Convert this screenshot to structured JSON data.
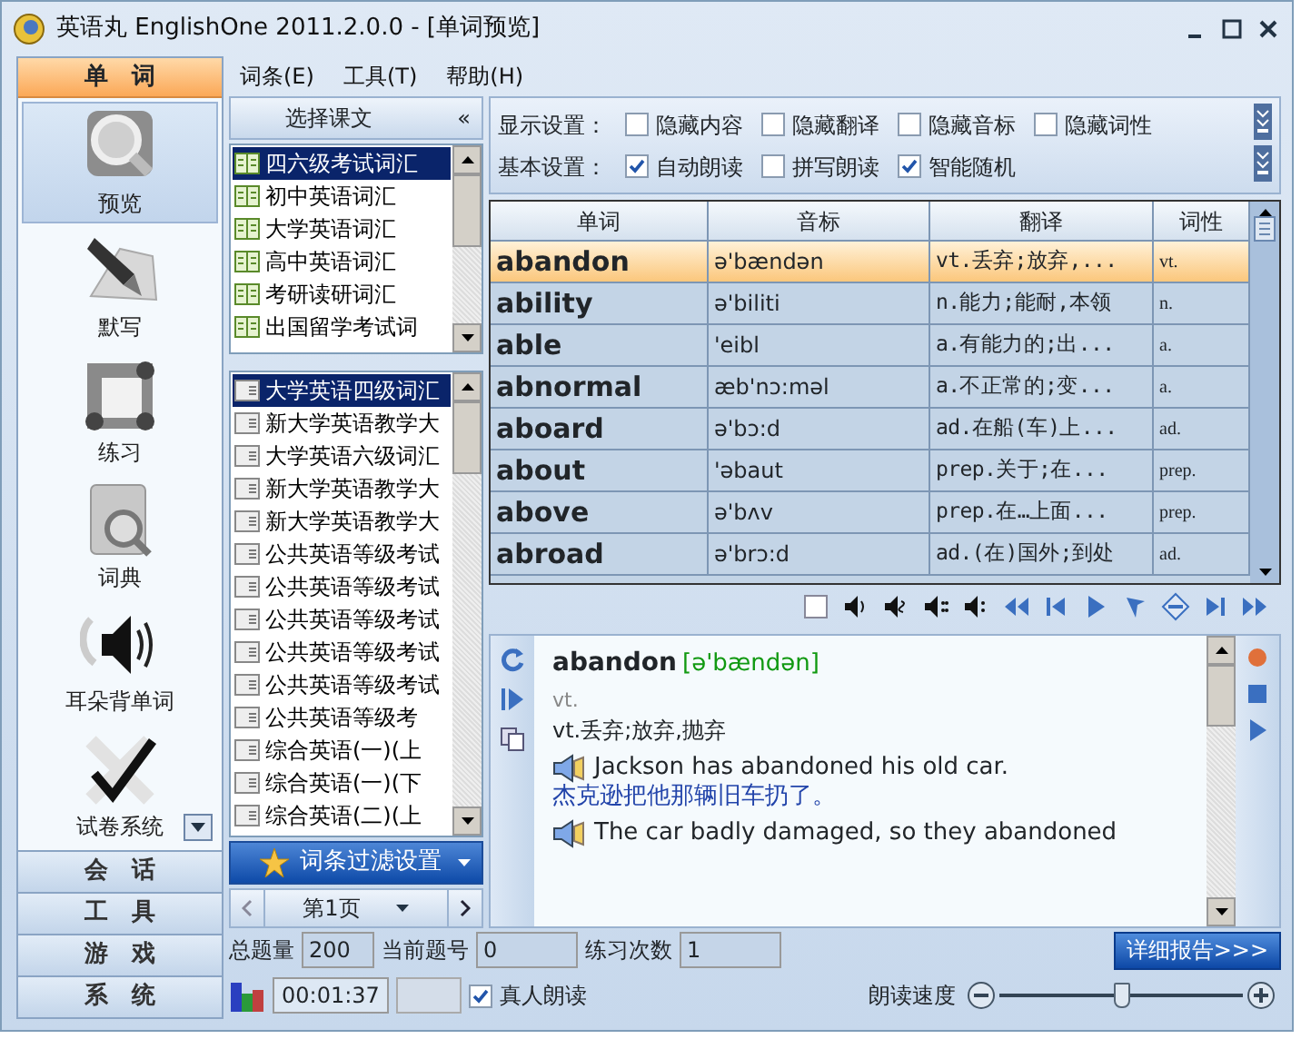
{
  "window": {
    "title": "英语丸  EnglishOne 2011.2.0.0 - [单词预览]"
  },
  "sidebar": {
    "header": "单　词",
    "tools": [
      {
        "label": "预览",
        "kind": "magnifier",
        "selected": true
      },
      {
        "label": "默写",
        "kind": "pen",
        "selected": false
      },
      {
        "label": "练习",
        "kind": "practice",
        "selected": false
      },
      {
        "label": "词典",
        "kind": "dictionary",
        "selected": false
      },
      {
        "label": "耳朵背单词",
        "kind": "speaker",
        "selected": false
      },
      {
        "label": "试卷系统",
        "kind": "check",
        "selected": false
      }
    ],
    "sections": [
      "会　话",
      "工　具",
      "游　戏",
      "系　统"
    ]
  },
  "menu": [
    "词条(E)",
    "工具(T)",
    "帮助(H)"
  ],
  "courses": {
    "title": "选择课文",
    "collapse": "«",
    "categories": [
      {
        "label": "四六级考试词汇",
        "selected": true
      },
      {
        "label": "初中英语词汇",
        "selected": false
      },
      {
        "label": "大学英语词汇",
        "selected": false
      },
      {
        "label": "高中英语词汇",
        "selected": false
      },
      {
        "label": "考研读研词汇",
        "selected": false
      },
      {
        "label": "出国留学考试词",
        "selected": false
      }
    ],
    "books": [
      {
        "label": "大学英语四级词汇",
        "selected": true
      },
      {
        "label": "新大学英语教学大",
        "selected": false
      },
      {
        "label": "大学英语六级词汇",
        "selected": false
      },
      {
        "label": "新大学英语教学大",
        "selected": false
      },
      {
        "label": "新大学英语教学大",
        "selected": false
      },
      {
        "label": "公共英语等级考试",
        "selected": false
      },
      {
        "label": "公共英语等级考试",
        "selected": false
      },
      {
        "label": "公共英语等级考试",
        "selected": false
      },
      {
        "label": "公共英语等级考试",
        "selected": false
      },
      {
        "label": "公共英语等级考试",
        "selected": false
      },
      {
        "label": "公共英语等级考",
        "selected": false
      },
      {
        "label": "综合英语(一)(上",
        "selected": false
      },
      {
        "label": "综合英语(一)(下",
        "selected": false
      },
      {
        "label": "综合英语(二)(上",
        "selected": false
      }
    ],
    "filter_button": "词条过滤设置",
    "page": "第1页"
  },
  "settings": {
    "display_label": "显示设置：",
    "display": [
      {
        "label": "隐藏内容",
        "checked": false
      },
      {
        "label": "隐藏翻译",
        "checked": false
      },
      {
        "label": "隐藏音标",
        "checked": false
      },
      {
        "label": "隐藏词性",
        "checked": false
      }
    ],
    "basic_label": "基本设置：",
    "basic": [
      {
        "label": "自动朗读",
        "checked": true
      },
      {
        "label": "拼写朗读",
        "checked": false
      },
      {
        "label": "智能随机",
        "checked": true
      }
    ]
  },
  "table": {
    "columns": [
      "单词",
      "音标",
      "翻译",
      "词性"
    ],
    "rows": [
      {
        "word": "abandon",
        "phonetic": "ə'bændən",
        "translation": "vt.丢弃;放弃,...",
        "pos": "vt.",
        "selected": true
      },
      {
        "word": "ability",
        "phonetic": "ə'biliti",
        "translation": "n.能力;能耐,本领",
        "pos": "n.",
        "selected": false
      },
      {
        "word": "able",
        "phonetic": "'eibl",
        "translation": "a.有能力的;出...",
        "pos": "a.",
        "selected": false
      },
      {
        "word": "abnormal",
        "phonetic": "æb'nɔ:məl",
        "translation": "a.不正常的;变...",
        "pos": "a.",
        "selected": false
      },
      {
        "word": "aboard",
        "phonetic": "ə'bɔ:d",
        "translation": "ad.在船(车)上...",
        "pos": "ad.",
        "selected": false
      },
      {
        "word": "about",
        "phonetic": "'əbaut",
        "translation": "prep.关于;在...",
        "pos": "prep.",
        "selected": false
      },
      {
        "word": "above",
        "phonetic": "ə'bʌv",
        "translation": "prep.在…上面...",
        "pos": "prep.",
        "selected": false
      },
      {
        "word": "abroad",
        "phonetic": "ə'brɔ:d",
        "translation": "ad.(在)国外;到处",
        "pos": "ad.",
        "selected": false
      }
    ]
  },
  "detail": {
    "word": "abandon",
    "phonetic": "[ə'bændən]",
    "pos": "vt.",
    "definition": "vt.丢弃;放弃,抛弃",
    "examples": [
      {
        "en": "Jackson has abandoned his old car.",
        "zh": "杰克逊把他那辆旧车扔了。"
      },
      {
        "en": "The car badly damaged, so they abandoned"
      }
    ]
  },
  "stats": [
    {
      "label": "总题量",
      "value": "200"
    },
    {
      "label": "当前题号",
      "value": "0"
    },
    {
      "label": "练习次数",
      "value": "1"
    }
  ],
  "report_button": "详细报告>>>",
  "status": {
    "time": "00:01:37",
    "real_voice": {
      "label": "真人朗读",
      "checked": true
    },
    "speed": {
      "label": "朗读速度",
      "level": 0.5
    }
  }
}
